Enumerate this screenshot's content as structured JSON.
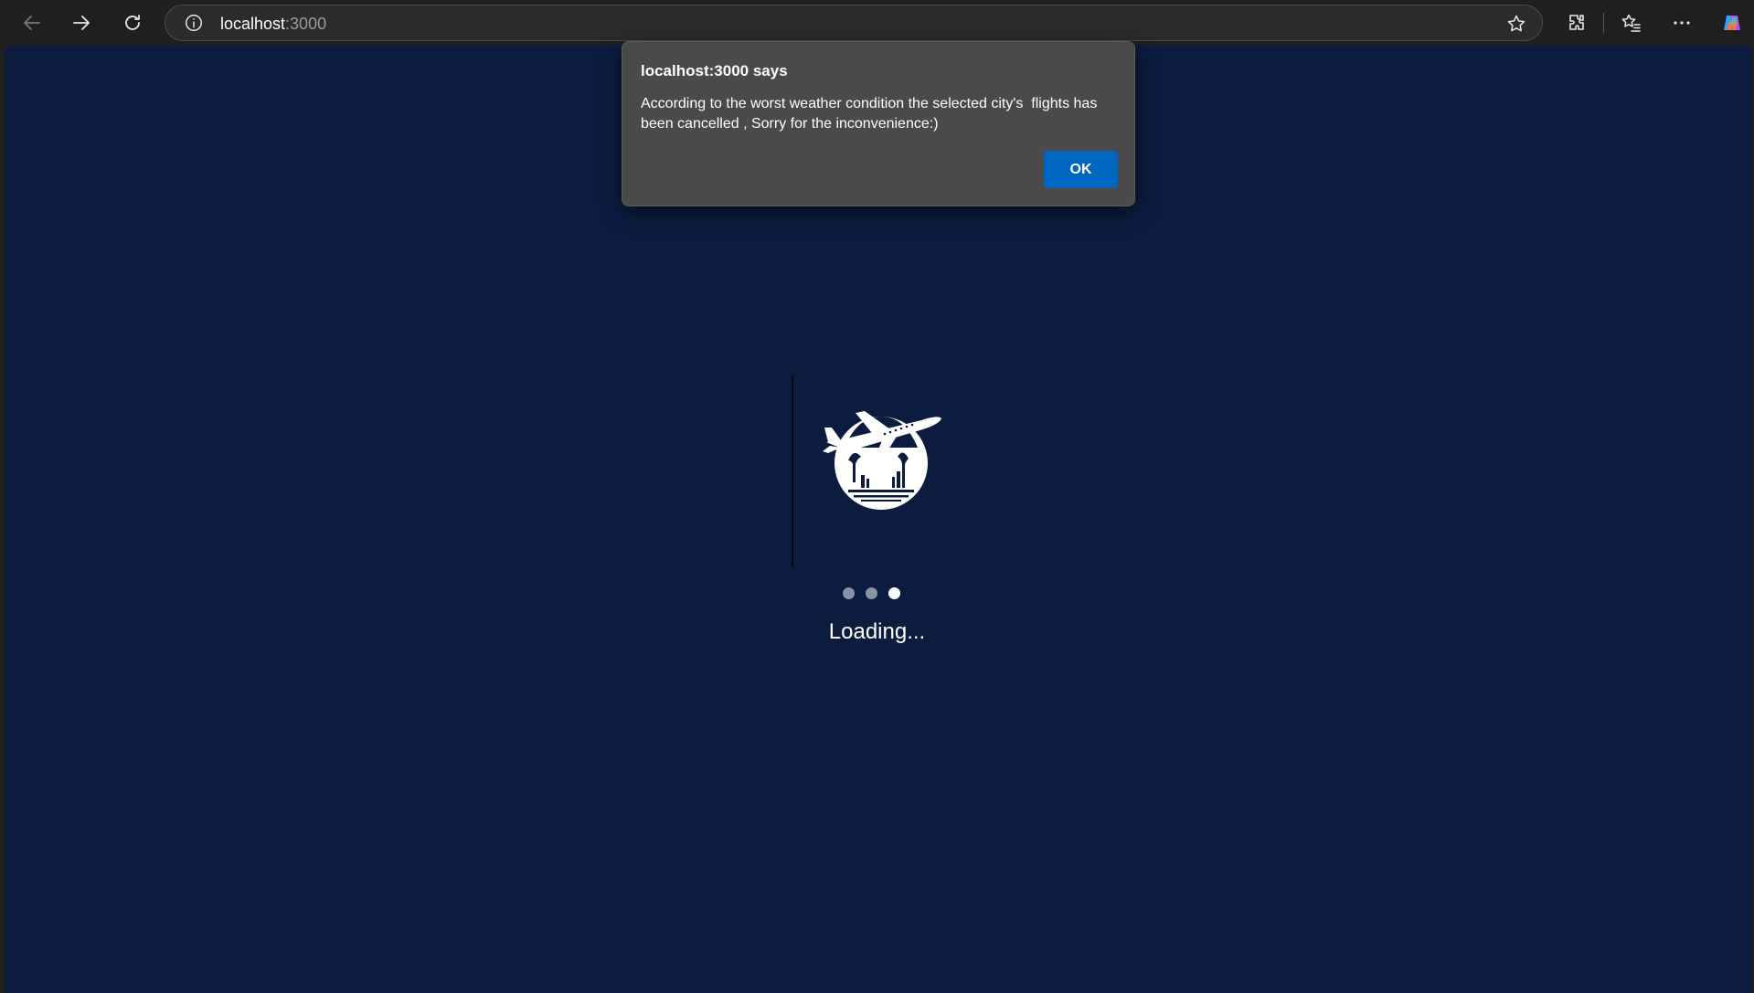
{
  "browser": {
    "address_host": "localhost",
    "address_port": ":3000",
    "icons": [
      "back-arrow-icon",
      "forward-arrow-icon",
      "refresh-icon",
      "info-icon",
      "star-icon",
      "extensions-icon",
      "favorites-icon",
      "more-icon",
      "copilot-icon"
    ]
  },
  "page": {
    "loading_text": "Loading...",
    "background_color": "#0b1c3f",
    "dots": [
      {
        "state": "inactive",
        "color": "#8a93a6"
      },
      {
        "state": "inactive",
        "color": "#8a93a6"
      },
      {
        "state": "active",
        "color": "#ffffff"
      }
    ]
  },
  "dialog": {
    "title": "localhost:3000 says",
    "message": "According to the worst weather condition the selected city's  flights has been cancelled , Sorry for the inconvenience:)",
    "ok_label": "OK",
    "ok_color": "#0067c0"
  }
}
